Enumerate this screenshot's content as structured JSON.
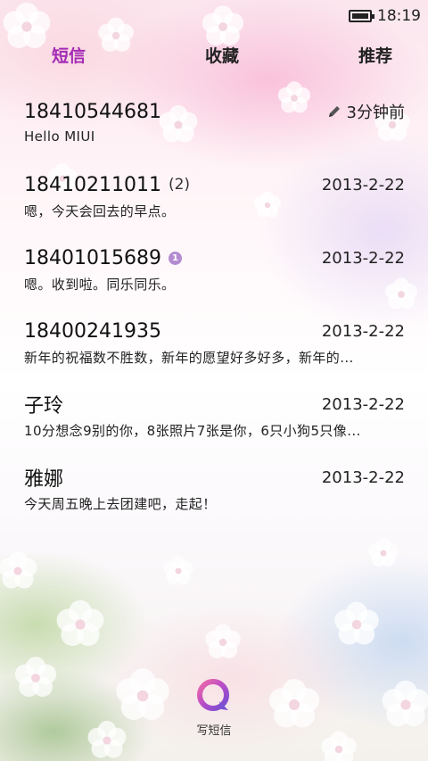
{
  "status_bar": {
    "time": "18:19",
    "battery_icon": "battery-full-icon"
  },
  "tabs": [
    {
      "label": "短信",
      "active": true
    },
    {
      "label": "收藏",
      "active": false
    },
    {
      "label": "推荐",
      "active": false
    }
  ],
  "conversations": [
    {
      "name": "18410544681",
      "count": "",
      "unread": "",
      "time": "3分钟前",
      "draft_icon": "pencil-icon",
      "preview": "Hello MIUI"
    },
    {
      "name": "18410211011",
      "count": "(2)",
      "unread": "",
      "time": "2013-2-22",
      "preview": "嗯，今天会回去的早点。"
    },
    {
      "name": "18401015689",
      "count": "",
      "unread": "1",
      "time": "2013-2-22",
      "preview": "嗯。收到啦。同乐同乐。"
    },
    {
      "name": "18400241935",
      "count": "",
      "unread": "",
      "time": "2013-2-22",
      "preview": "新年的祝福数不胜数，新年的愿望好多好多，新年的..."
    },
    {
      "name": "子玲",
      "count": "",
      "unread": "",
      "time": "2013-2-22",
      "preview": "10分想念9别的你，8张照片7张是你，6只小狗5只像..."
    },
    {
      "name": "雅娜",
      "count": "",
      "unread": "",
      "time": "2013-2-22",
      "preview": "今天周五晚上去团建吧，走起！"
    }
  ],
  "compose": {
    "label": "写短信",
    "icon": "compose-message-icon"
  },
  "colors": {
    "accent": "#a32ab5",
    "badge": "#b48bd0"
  }
}
